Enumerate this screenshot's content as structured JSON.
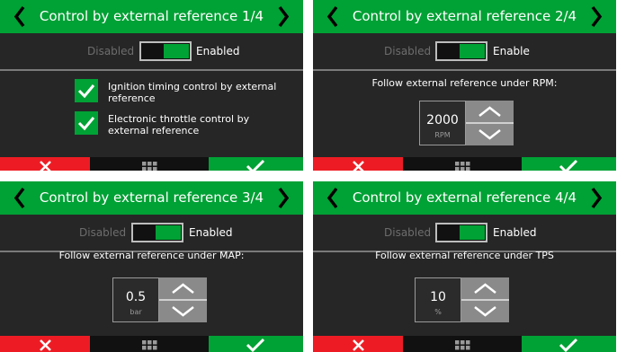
{
  "colors": {
    "accent_green": "#00a135",
    "cancel_red": "#ed1c24",
    "panel_bg": "#262626"
  },
  "panels": [
    {
      "title": "Control by external reference 1/4",
      "toggle": {
        "off_label": "Disabled",
        "on_label": "Enabled",
        "state": "on"
      },
      "checkboxes": [
        {
          "label": "Ignition timing control by external reference",
          "checked": true
        },
        {
          "label": "Electronic throttle control by external reference",
          "checked": true
        }
      ]
    },
    {
      "title": "Control by external reference 2/4",
      "toggle": {
        "off_label": "Disabled",
        "on_label": "Enable",
        "state": "on"
      },
      "caption": "Follow external reference under RPM:",
      "stepper": {
        "value": "2000",
        "unit": "RPM"
      }
    },
    {
      "title": "Control by external reference 3/4",
      "toggle": {
        "off_label": "Disabled",
        "on_label": "Enabled",
        "state": "on"
      },
      "caption": "Follow external reference under MAP:",
      "stepper": {
        "value": "0.5",
        "unit": "bar"
      }
    },
    {
      "title": "Control by external reference 4/4",
      "toggle": {
        "off_label": "Disabled",
        "on_label": "Enabled",
        "state": "on"
      },
      "caption": "Follow external reference under TPS",
      "stepper": {
        "value": "10",
        "unit": "%"
      }
    }
  ],
  "icons": {
    "prev": "chevron-left-icon",
    "next": "chevron-right-icon",
    "cancel": "close-icon",
    "menu": "grid-menu-icon",
    "confirm": "check-icon",
    "up": "chevron-up-icon",
    "down": "chevron-down-icon"
  }
}
